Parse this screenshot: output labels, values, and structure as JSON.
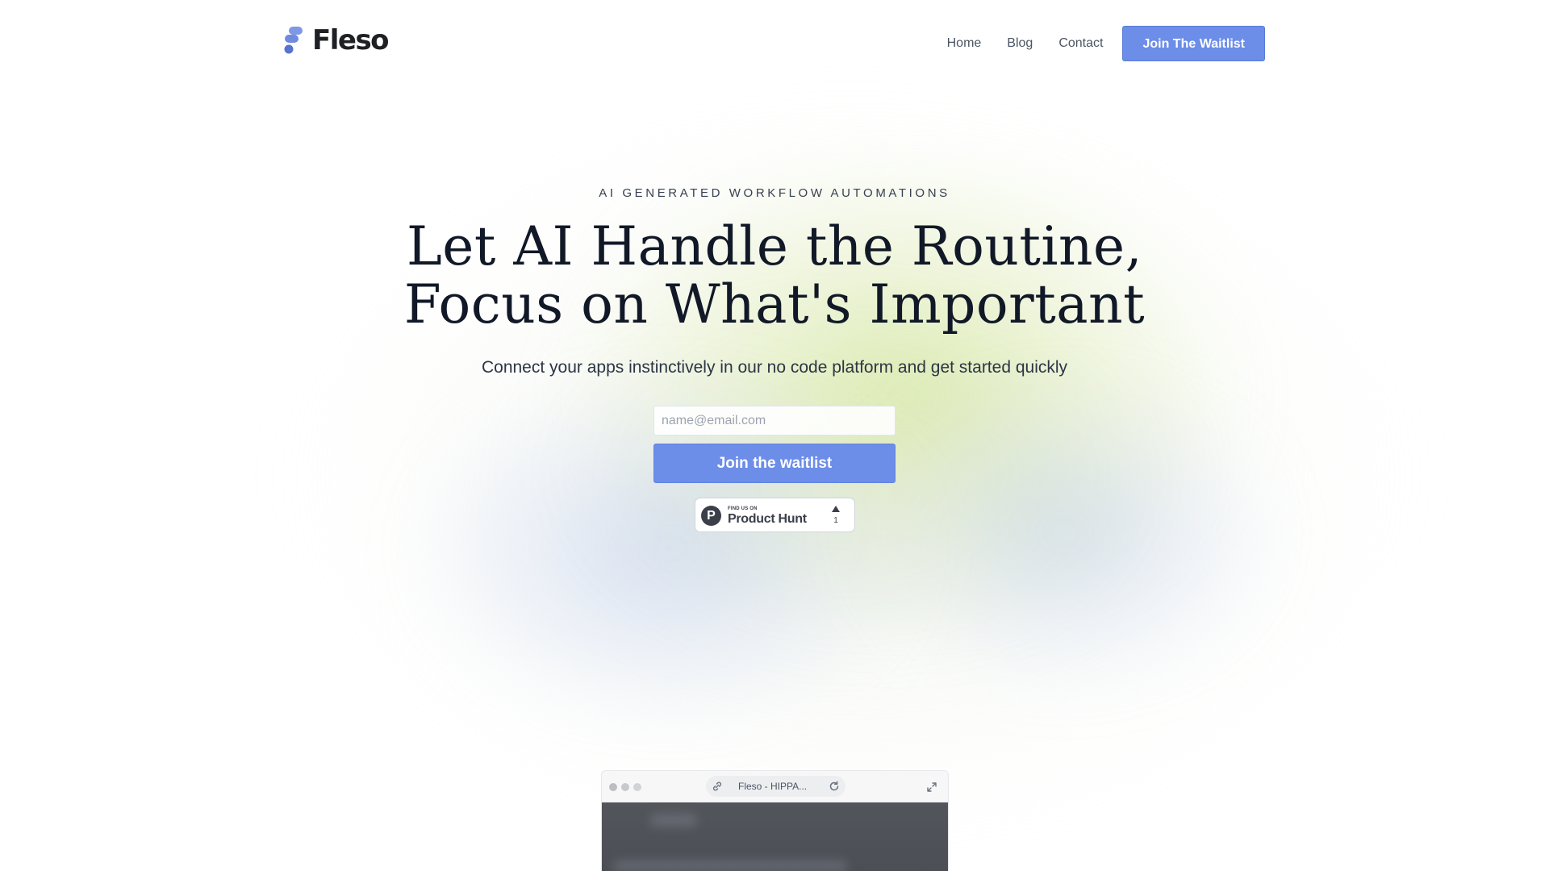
{
  "brand": {
    "name": "Fleso",
    "accent": "#6c8de8"
  },
  "nav": {
    "items": [
      {
        "label": "Home"
      },
      {
        "label": "Blog"
      },
      {
        "label": "Contact"
      }
    ],
    "cta_label": "Join The Waitlist"
  },
  "hero": {
    "eyebrow": "AI GENERATED WORKFLOW AUTOMATIONS",
    "headline_line1": "Let AI Handle the Routine,",
    "headline_line2": "Focus on What's Important",
    "subheadline": "Connect your apps instinctively in our no code platform and get started quickly",
    "email_placeholder": "name@email.com",
    "email_value": "",
    "submit_label": "Join the waitlist"
  },
  "product_hunt": {
    "find_us": "FIND US ON",
    "name": "Product Hunt",
    "logo_letter": "P",
    "upvotes": "1"
  },
  "browser_preview": {
    "url_text": "Fleso - HIPPA..."
  }
}
